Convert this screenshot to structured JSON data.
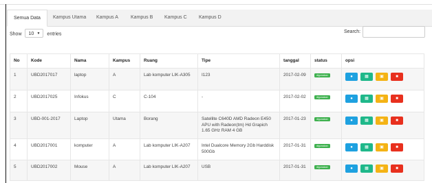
{
  "tabs": [
    "Semua Data",
    "Kampus Utama",
    "Kampus A",
    "Kampus B",
    "Kampus C",
    "Kampus D"
  ],
  "length": {
    "prefix": "Show",
    "value": "10",
    "suffix": "entries"
  },
  "search": {
    "label": "Search:",
    "value": ""
  },
  "table": {
    "headers": [
      "No",
      "Kode",
      "Nama",
      "Kampus",
      "Ruang",
      "Tipe",
      "tanggal",
      "status",
      "opsi"
    ],
    "rows": [
      {
        "no": "1",
        "kode": "UBD2017017",
        "nama": "laptop",
        "kampus": "A",
        "ruang": "Lab komputer LIK-A305",
        "tipe": "I123",
        "tanggal": "2017-02-09",
        "status": "digunakan"
      },
      {
        "no": "2",
        "kode": "UBD2017025",
        "nama": "Infokus",
        "kampus": "C",
        "ruang": "C-104",
        "tipe": "-",
        "tanggal": "2017-02-02",
        "status": "digunakan"
      },
      {
        "no": "3",
        "kode": "UBD-001-2017",
        "nama": "Laptop",
        "kampus": "Utama",
        "ruang": "Borang",
        "tipe": "Satellite C640D AMD Radeon E450 APU with Radeon(tm) Hd Grapich 1.65 GHz RAM 4 GB",
        "tanggal": "2017-01-23",
        "status": "digunakan"
      },
      {
        "no": "4",
        "kode": "UBD2017001",
        "nama": "komputer",
        "kampus": "A",
        "ruang": "Lab komputer LIK-A207",
        "tipe": "Intel Dualcore Memory 2Gb Harddisk 500Gb",
        "tanggal": "2017-01-31",
        "status": "digunakan"
      },
      {
        "no": "5",
        "kode": "UBD2017002",
        "nama": "Mouse",
        "kampus": "A",
        "ruang": "Lab komputer LIK-A207",
        "tipe": "USB",
        "tanggal": "2017-01-31",
        "status": "digunakan"
      }
    ]
  },
  "action_icons": [
    "view-icon",
    "edit-icon",
    "print-icon",
    "delete-icon"
  ],
  "colors": {
    "view": "#1ea1e0",
    "edit": "#1fb88a",
    "print": "#f4b315",
    "delete": "#e8301e",
    "status": "#3fb14f"
  }
}
